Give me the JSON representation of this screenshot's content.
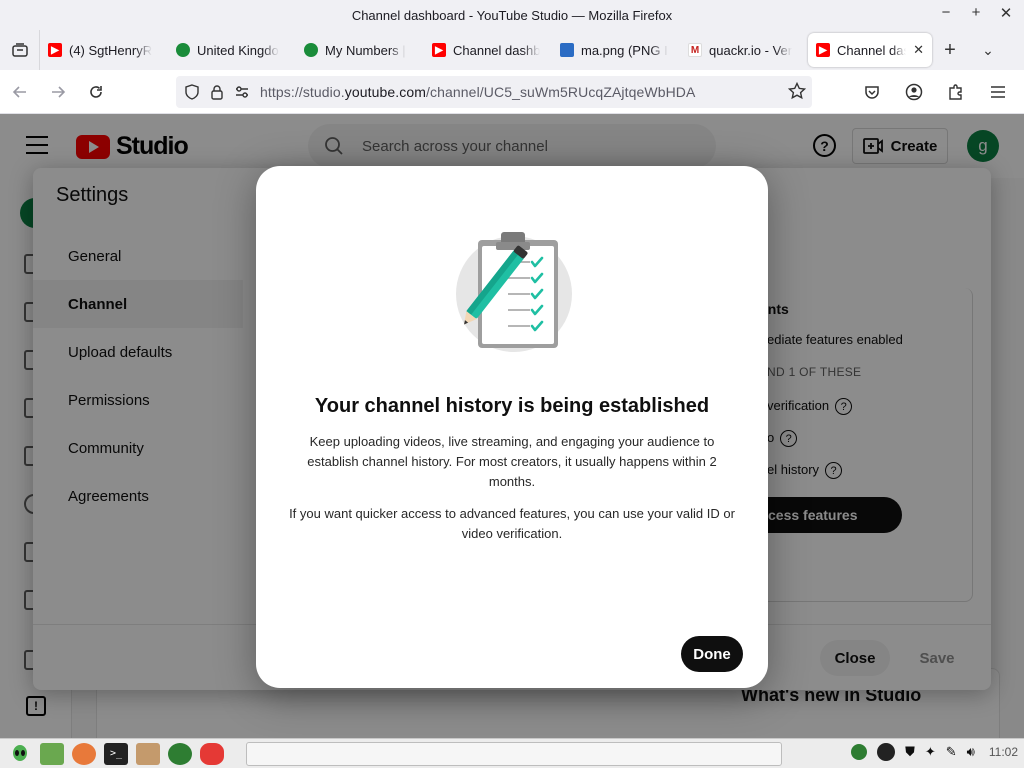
{
  "window": {
    "title": "Channel dashboard - YouTube Studio — Mozilla Firefox",
    "controls": [
      "−",
      "+",
      "✕"
    ]
  },
  "tabs": [
    {
      "label": "(4) SgtHenryR",
      "icon": "youtube-icon",
      "color": "#ff0000"
    },
    {
      "label": "United Kingdo",
      "icon": "globe-icon",
      "color": "#1a8c3a"
    },
    {
      "label": "My Numbers |",
      "icon": "globe-icon",
      "color": "#1a8c3a"
    },
    {
      "label": "Channel dashb",
      "icon": "youtube-icon",
      "color": "#ff0000"
    },
    {
      "label": "ma.png (PNG I",
      "icon": "image-icon",
      "color": "#2b6cc4"
    },
    {
      "label": "quackr.io - Ver",
      "icon": "gmail-icon",
      "color": "#c5221f"
    },
    {
      "label": "Channel das",
      "icon": "youtube-icon",
      "color": "#ff0000",
      "active": true
    }
  ],
  "url": {
    "prefix": "https://studio.",
    "domain": "youtube.com",
    "path": "/channel/UC5_suWm5RUcqZAjtqeWbHDA"
  },
  "studio": {
    "brand": "Studio",
    "search_placeholder": "Search across your channel",
    "help": "?",
    "create_label": "Create",
    "avatar_letter": "g",
    "whats_new": "What's new in Studio"
  },
  "settings": {
    "title": "Settings",
    "nav": [
      "General",
      "Channel",
      "Upload defaults",
      "Permissions",
      "Community",
      "Agreements"
    ],
    "active_index": 1,
    "panel": {
      "heading_partial": "ents",
      "line1": "ediate features enabled",
      "line2": "ND 1 OF THESE",
      "line3": "verification",
      "line4": "o",
      "line5": "el history",
      "access_button": "cess features"
    },
    "close_label": "Close",
    "save_label": "Save"
  },
  "modal": {
    "title": "Your channel history is being established",
    "paragraph1": "Keep uploading videos, live streaming, and engaging your audience to establish channel history. For most creators, it usually happens within 2 months.",
    "paragraph2": "If you want quicker access to advanced features, you can use your valid ID or video verification.",
    "done_label": "Done"
  },
  "taskbar": {
    "clock": "11:02"
  }
}
